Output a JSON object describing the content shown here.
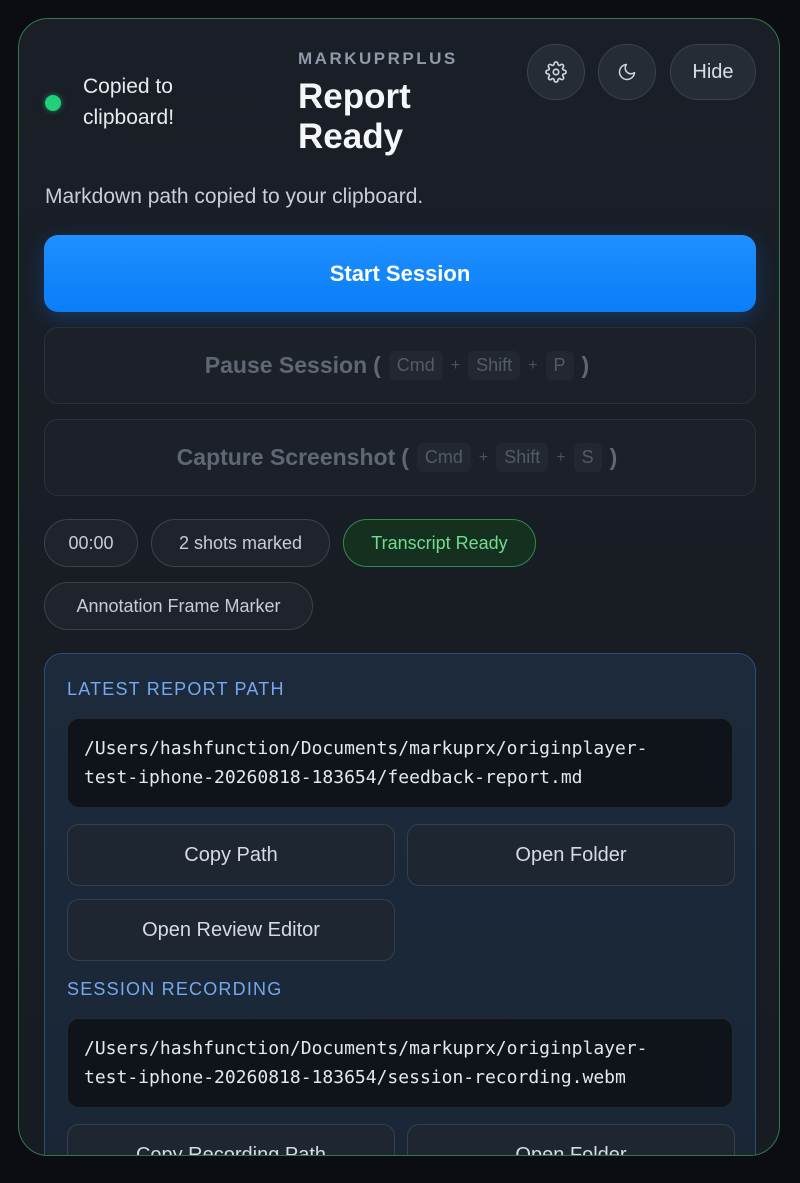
{
  "status": {
    "text_line1": "Copied to",
    "text_line2": "clipboard!",
    "color": "#22d07a"
  },
  "header": {
    "brand": "MARKUPRPLUS",
    "title_line1": "Report",
    "title_line2": "Ready",
    "settings_icon": "gear-icon",
    "theme_icon": "moon-icon",
    "hide_label": "Hide"
  },
  "subtitle": "Markdown path copied to your clipboard.",
  "actions": {
    "start_label": "Start Session",
    "pause_label": "Pause Session",
    "pause_keys": [
      "Cmd",
      "Shift",
      "P"
    ],
    "capture_label": "Capture Screenshot",
    "capture_keys": [
      "Cmd",
      "Shift",
      "S"
    ],
    "accent_color": "#0b7df7"
  },
  "pills": {
    "timer": "00:00",
    "shots": "2 shots marked",
    "transcript": "Transcript Ready",
    "marker": "Annotation Frame Marker"
  },
  "report": {
    "label": "LATEST REPORT PATH",
    "path_line1": "/Users/hashfunction/Documents/markuprx/originplayer-",
    "path_line2": "test-iphone-20260818-183654/feedback-report.md",
    "copy_label": "Copy Path",
    "open_folder_label": "Open Folder",
    "review_label": "Open Review Editor"
  },
  "recording": {
    "label": "SESSION RECORDING",
    "path_line1": "/Users/hashfunction/Documents/markuprx/originplayer-",
    "path_line2": "test-iphone-20260818-183654/session-recording.webm",
    "copy_label": "Copy Recording Path",
    "open_folder_label": "Open Folder"
  }
}
